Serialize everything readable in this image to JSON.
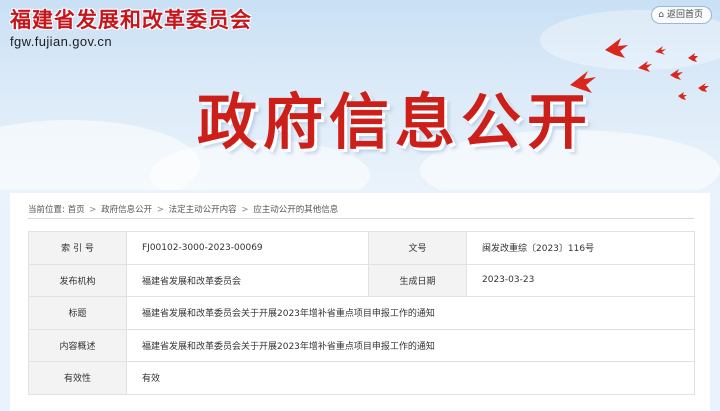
{
  "header": {
    "site_title": "福建省发展和改革委员会",
    "site_domain": "fgw.fujian.gov.cn",
    "back_home_label": "返回首页",
    "back_home_icon": "home-icon",
    "section_title": "政府信息公开",
    "title_color": "#c6161d"
  },
  "breadcrumb": {
    "prefix": "当前位置:",
    "items": [
      "首页",
      "政府信息公开",
      "法定主动公开内容",
      "应主动公开的其他信息"
    ],
    "separator": ">"
  },
  "info_table": {
    "index_label": "索 引 号",
    "index_value": "FJ00102-3000-2023-00069",
    "doc_no_label": "文号",
    "doc_no_value": "闽发改重综〔2023〕116号",
    "publisher_label": "发布机构",
    "publisher_value": "福建省发展和改革委员会",
    "date_label": "生成日期",
    "date_value": "2023-03-23",
    "title_label": "标题",
    "title_value": "福建省发展和改革委员会关于开展2023年增补省重点项目申报工作的通知",
    "summary_label": "内容概述",
    "summary_value": "福建省发展和改革委员会关于开展2023年增补省重点项目申报工作的通知",
    "validity_label": "有效性",
    "validity_value": "有效"
  }
}
